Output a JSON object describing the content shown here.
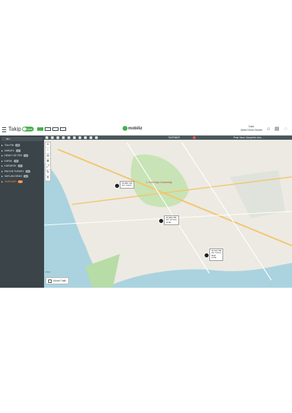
{
  "header": {
    "menu_icon": "hamburger-icon",
    "title": "Takip",
    "live_label": "Canlı",
    "logo": "mobiliz",
    "user_name": "Fatih",
    "user_company": "Şirket Demo Hesabı"
  },
  "sidebar": {
    "search_placeholder": "Ara",
    "groups": [
      {
        "label": "Tüm Filo",
        "count": "34",
        "selected": false
      },
      {
        "label": "AKBURL",
        "count": "3",
        "selected": false
      },
      {
        "label": "DEMO HİZ.TER",
        "count": "2",
        "selected": false
      },
      {
        "label": "KARAL",
        "count": "8",
        "selected": false
      },
      {
        "label": "KARAKOK",
        "count": "3",
        "selected": false
      },
      {
        "label": "RACON TURKEY",
        "count": "6",
        "selected": false
      },
      {
        "label": "SAYLAN DEMO",
        "count": "2",
        "selected": false
      },
      {
        "label": "TASFINER",
        "count": "6",
        "selected": true
      }
    ]
  },
  "map": {
    "selected_group": "TASFİNER",
    "address": "Pınar Yanın, Sarıyer/ist. Av.b...",
    "traffic_label": "Güncel Trafik",
    "scale_label": "1 km",
    "markers": [
      {
        "line1": "34 ABC 123",
        "line2": "Hız: 0 km/s"
      },
      {
        "line1": "34 DEF 456",
        "line2": "Hız: 12 km/s",
        "line3": "14:05"
      },
      {
        "line1": "34 GHI 789",
        "line2": "Hız: 0 km/s",
        "line3": "Mola",
        "line4": "13:52"
      }
    ],
    "place_label": "1. Ordu Topçu Komutanlığı"
  }
}
